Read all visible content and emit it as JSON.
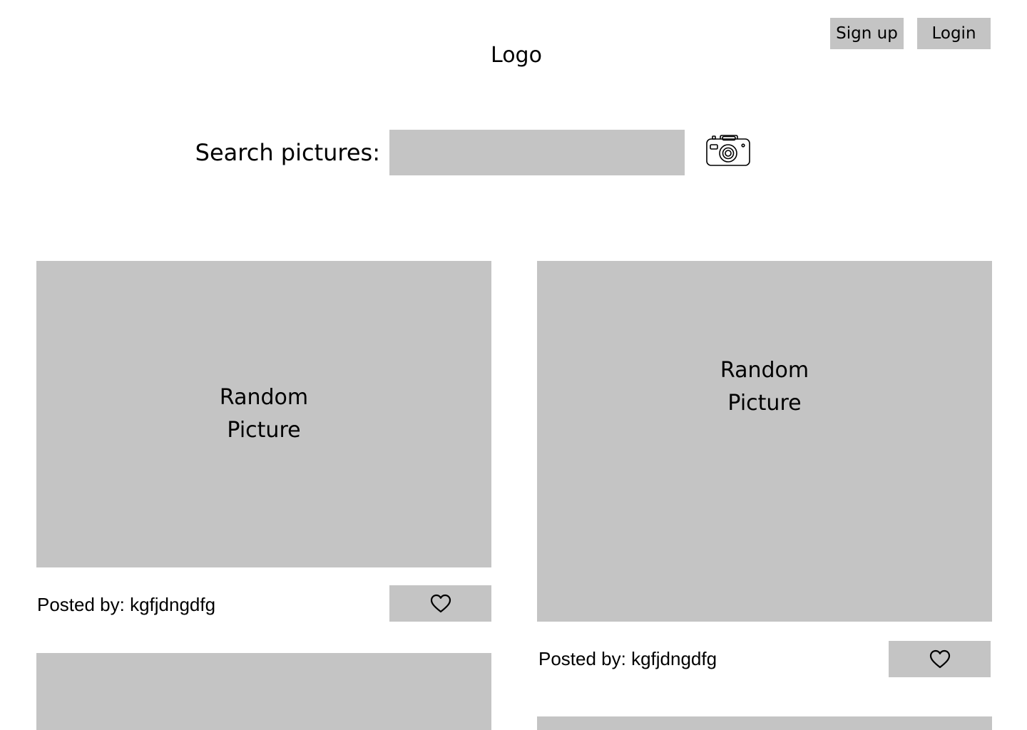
{
  "header": {
    "logo": "Logo",
    "signup_label": "Sign up",
    "login_label": "Login"
  },
  "search": {
    "label": "Search pictures:",
    "value": "",
    "placeholder": "",
    "camera_icon": "camera-icon"
  },
  "posts": [
    {
      "picture_line1": "Random",
      "picture_line2": "Picture",
      "posted_by": "Posted by: kgfjdngdfg",
      "like_icon": "heart-icon"
    },
    {
      "picture_line1": "Random",
      "picture_line2": "Picture",
      "posted_by": "Posted by: kgfjdngdfg",
      "like_icon": "heart-icon"
    }
  ],
  "colors": {
    "placeholder_gray": "#c4c4c4",
    "background": "#ffffff",
    "text": "#000000"
  }
}
